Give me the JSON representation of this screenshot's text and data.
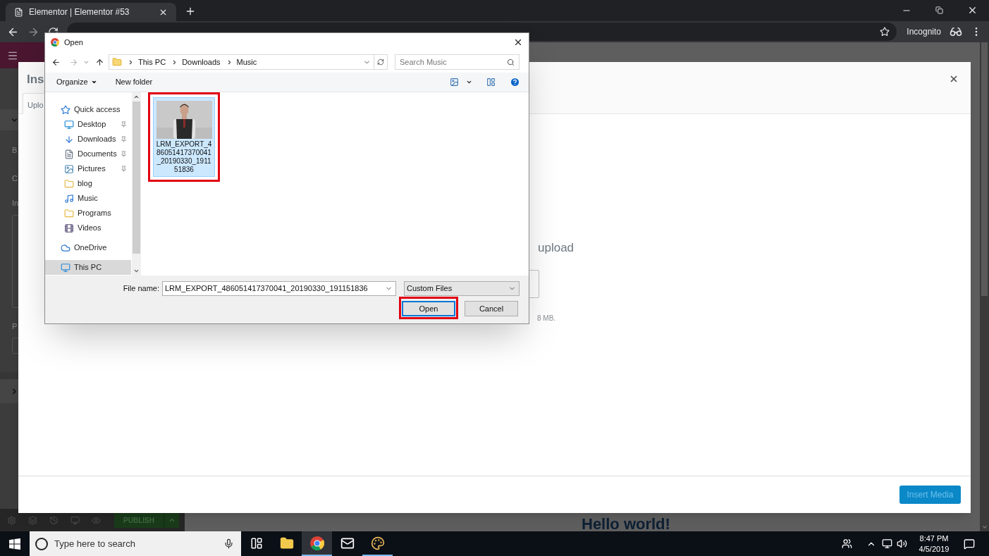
{
  "browser": {
    "tab": {
      "title": "Elementor | Elementor #53"
    },
    "profile_label": "Incognito"
  },
  "editor": {
    "panel_labels": [
      "B",
      "C",
      "In",
      "P"
    ],
    "publish_button": "PUBLISH",
    "canvas_heading": "Hello world!"
  },
  "media_modal": {
    "title": "Ins",
    "tabs": [
      {
        "label": "Uplo",
        "selected": true
      }
    ],
    "drop_text": "upload",
    "size_note": "8 MB.",
    "insert_button": "Insert Media"
  },
  "open_dialog": {
    "title": "Open",
    "path": [
      "This PC",
      "Downloads",
      "Music"
    ],
    "search_placeholder": "Search Music",
    "toolbar": [
      {
        "label": "Organize",
        "dropdown": true
      },
      {
        "label": "New folder",
        "dropdown": false
      }
    ],
    "nav": [
      {
        "label": "Quick access",
        "kind": "star",
        "selected": false,
        "children": [
          {
            "label": "Desktop",
            "kind": "desktop",
            "pinned": true,
            "selected": false
          },
          {
            "label": "Downloads",
            "kind": "download",
            "pinned": true,
            "selected": false
          },
          {
            "label": "Documents",
            "kind": "document",
            "pinned": true,
            "selected": false
          },
          {
            "label": "Pictures",
            "kind": "pictures",
            "pinned": true,
            "selected": false
          },
          {
            "label": "blog",
            "kind": "folder",
            "pinned": false,
            "selected": false
          },
          {
            "label": "Music",
            "kind": "music",
            "pinned": false,
            "selected": false
          },
          {
            "label": "Programs",
            "kind": "folder",
            "pinned": false,
            "selected": false
          },
          {
            "label": "Videos",
            "kind": "videos",
            "pinned": false,
            "selected": false
          }
        ]
      },
      {
        "label": "OneDrive",
        "kind": "cloud",
        "selected": false
      },
      {
        "label": "This PC",
        "kind": "pc",
        "selected": true
      }
    ],
    "files": [
      {
        "name": "LRM_EXPORT_486051417370041_20190330_191151836",
        "selected": true,
        "highlighted": true
      }
    ],
    "file_name_label": "File name:",
    "file_name": "LRM_EXPORT_486051417370041_20190330_191151836",
    "file_type": "Custom Files",
    "buttons": [
      {
        "label": "Open",
        "kind": "primary",
        "highlighted": true
      },
      {
        "label": "Cancel",
        "kind": "secondary",
        "highlighted": false
      }
    ]
  },
  "taskbar": {
    "search_placeholder": "Type here to search",
    "apps": [
      {
        "kind": "task-view",
        "running": false,
        "active": false
      },
      {
        "kind": "explorer",
        "running": false,
        "active": false
      },
      {
        "kind": "chrome",
        "running": true,
        "active": true
      },
      {
        "kind": "mail",
        "running": false,
        "active": false
      },
      {
        "kind": "paint",
        "running": true,
        "active": false
      }
    ],
    "clock": {
      "time": "8:47 PM",
      "date": "4/5/2019"
    }
  }
}
